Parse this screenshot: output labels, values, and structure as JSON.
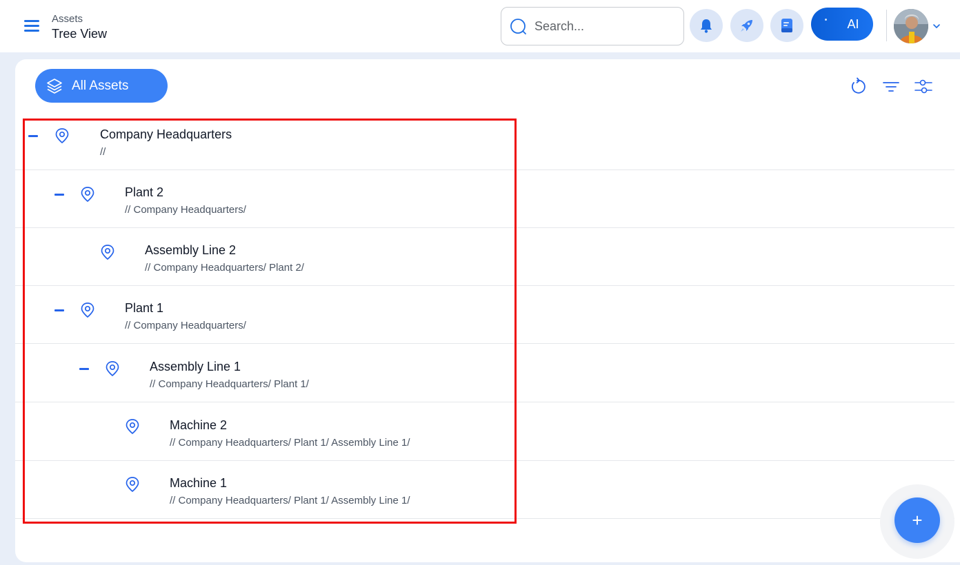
{
  "header": {
    "breadcrumb_parent": "Assets",
    "page_title": "Tree View",
    "search_placeholder": "Search...",
    "ai_label": "AI"
  },
  "toolbar": {
    "filter_label": "All Assets"
  },
  "tree": [
    {
      "name": "Company Headquarters",
      "path": "//",
      "collapsible": true
    },
    {
      "name": "Plant 2",
      "path": "// Company Headquarters/",
      "collapsible": true
    },
    {
      "name": "Assembly Line 2",
      "path": "// Company Headquarters/ Plant 2/",
      "collapsible": false
    },
    {
      "name": "Plant 1",
      "path": "// Company Headquarters/",
      "collapsible": true
    },
    {
      "name": "Assembly Line 1",
      "path": "// Company Headquarters/ Plant 1/",
      "collapsible": true
    },
    {
      "name": "Machine 2",
      "path": "// Company Headquarters/ Plant 1/ Assembly Line 1/",
      "collapsible": false
    },
    {
      "name": "Machine 1",
      "path": "// Company Headquarters/ Plant 1/ Assembly Line 1/",
      "collapsible": false
    }
  ],
  "fab": {
    "label": "+"
  },
  "colors": {
    "accent": "#3b82f6",
    "icon_blue": "#2563eb",
    "highlight": "#ef0f0f"
  },
  "icons": [
    "menu-icon",
    "search-icon",
    "bell-icon",
    "rocket-icon",
    "document-icon",
    "chevron-down-icon",
    "layers-icon",
    "refresh-icon",
    "filter-icon",
    "settings-sliders-icon",
    "location-pin-icon",
    "collapse-icon",
    "plus-icon"
  ]
}
